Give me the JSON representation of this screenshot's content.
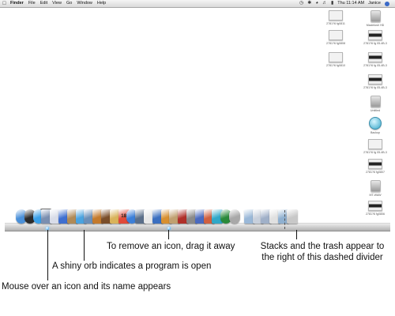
{
  "menubar": {
    "apple_icon": "apple-icon",
    "items": [
      "Finder",
      "File",
      "Edit",
      "View",
      "Go",
      "Window",
      "Help"
    ],
    "clock": "Thu 11:14 AM",
    "user": "Janice"
  },
  "desktop_icons": [
    {
      "label": "2781?6 fg0811",
      "icon": "screenshot-file-icon"
    },
    {
      "label": "Macintosh HD",
      "icon": "hard-drive-icon"
    },
    {
      "label": "2781?6 fg0808",
      "icon": "screenshot-file-icon"
    },
    {
      "label": "2781?6 fg 05-4B-3",
      "icon": "screenshot-file-icon"
    },
    {
      "label": "2781?6 fg0810",
      "icon": "screenshot-file-icon"
    },
    {
      "label": "2781?6 fg 05-4B-3",
      "icon": "screenshot-file-icon"
    },
    {
      "label": "2781?6 fg 05-4B-3",
      "icon": "screenshot-file-icon"
    },
    {
      "label": "Untitled",
      "icon": "disk-icon"
    },
    {
      "label": "Backup",
      "icon": "time-machine-disk-icon"
    },
    {
      "label": "2781?6 fg 05-4B-3",
      "icon": "screenshot-file-icon"
    },
    {
      "label": "2781?6 fg0807",
      "icon": "screenshot-file-icon"
    },
    {
      "label": "MT-WAW",
      "icon": "disk-icon"
    },
    {
      "label": "2781?6 fg0806",
      "icon": "screenshot-file-icon"
    }
  ],
  "dock": {
    "tooltip": "Safari",
    "calendar_day": "18",
    "icons": [
      {
        "name": "finder-icon",
        "color": "#4a90d9"
      },
      {
        "name": "dashboard-icon",
        "color": "#2b2b2b"
      },
      {
        "name": "safari-icon",
        "color": "#3aa0e8"
      },
      {
        "name": "mail-icon",
        "color": "#7a8fb0"
      },
      {
        "name": "ical-icon",
        "color": "#d8dce8"
      },
      {
        "name": "ichat-icon",
        "color": "#3f6fd0"
      },
      {
        "name": "address-book-icon",
        "color": "#b08a56"
      },
      {
        "name": "itunes-icon",
        "color": "#4aa3e0"
      },
      {
        "name": "iphoto-icon",
        "color": "#6b8fb8"
      },
      {
        "name": "imovie-icon",
        "color": "#c47a2c"
      },
      {
        "name": "idvd-icon",
        "color": "#7a4e2a"
      },
      {
        "name": "iweb-icon",
        "color": "#d9b35a"
      },
      {
        "name": "calendar-icon",
        "color": "#e04a3a"
      },
      {
        "name": "quicktime-icon",
        "color": "#3c7fd8"
      },
      {
        "name": "preview-icon",
        "color": "#5b6f8a"
      },
      {
        "name": "textedit-icon",
        "color": "#e8e8e8"
      },
      {
        "name": "keynote-icon",
        "color": "#3b6fc0"
      },
      {
        "name": "pages-icon",
        "color": "#d89030"
      },
      {
        "name": "garageband-icon",
        "color": "#c0a070"
      },
      {
        "name": "photo-booth-icon",
        "color": "#b0302a"
      },
      {
        "name": "system-preferences-icon",
        "color": "#8a8a8a"
      },
      {
        "name": "xcode-icon",
        "color": "#4a6ac0"
      },
      {
        "name": "grapher-icon",
        "color": "#d06040"
      },
      {
        "name": "utilities-icon",
        "color": "#30a8c8"
      },
      {
        "name": "time-machine-icon",
        "color": "#2a8a3a"
      },
      {
        "name": "spotlight-icon",
        "color": "#a8a8a8"
      },
      {
        "name": "downloads-stack-icon",
        "color": "#9ab8d8"
      },
      {
        "name": "documents-stack-icon",
        "color": "#c8d0dc"
      },
      {
        "name": "applications-stack-icon",
        "color": "#a0b0c8"
      },
      {
        "name": "screenshot-stack-icon",
        "color": "#e0e0e0"
      },
      {
        "name": "folder-stack-icon",
        "color": "#8fb0d0"
      },
      {
        "name": "trash-icon",
        "color": "#c8c8c8"
      }
    ]
  },
  "callouts": {
    "remove_icon": "To remove an icon, drag it away",
    "stacks_line1": "Stacks and the trash appear to",
    "stacks_line2": "the right of this dashed divider",
    "shiny_orb": "A shiny orb indicates a program is open",
    "mouse_over": "Mouse over an icon and its name appears"
  }
}
